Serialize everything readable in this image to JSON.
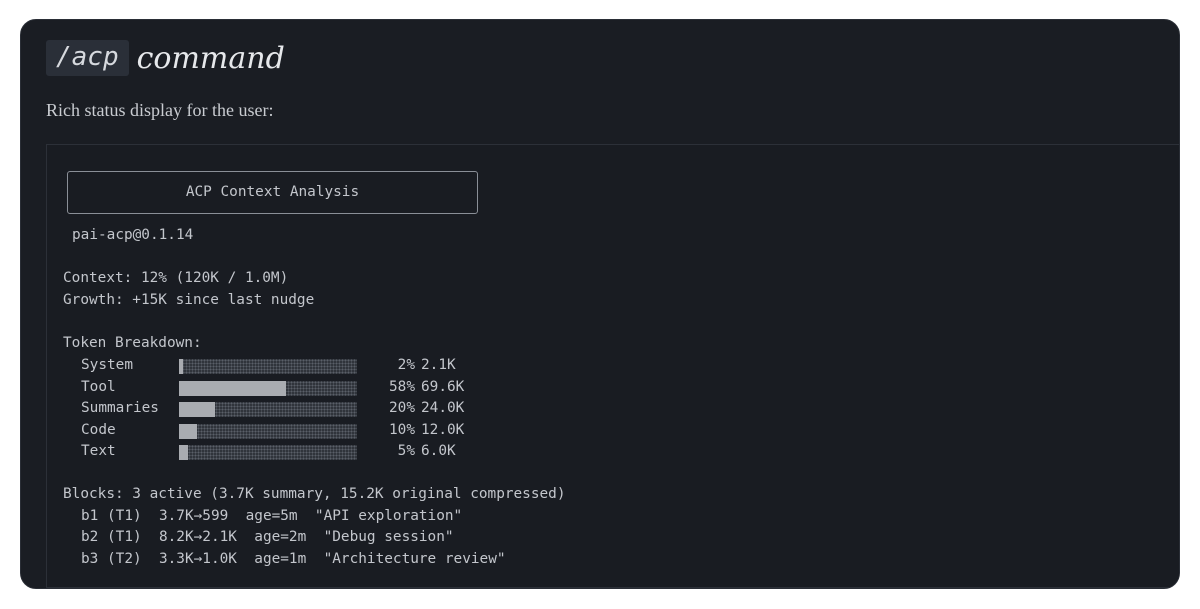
{
  "header": {
    "command": "/acp",
    "title_word": "command",
    "description": "Rich status display for the user:"
  },
  "terminal": {
    "box_title": "ACP Context Analysis",
    "version": "pai-acp@0.1.14",
    "context_line": "Context: 12% (120K / 1.0M)",
    "growth_line": "Growth: +15K since last nudge",
    "breakdown_heading": "Token Breakdown:",
    "breakdown": [
      {
        "name": "System",
        "fraction": 0.02,
        "pct": "2%",
        "tokens": "2.1K"
      },
      {
        "name": "Tool",
        "fraction": 0.6,
        "pct": "58%",
        "tokens": "69.6K"
      },
      {
        "name": "Summaries",
        "fraction": 0.2,
        "pct": "20%",
        "tokens": "24.0K"
      },
      {
        "name": "Code",
        "fraction": 0.1,
        "pct": "10%",
        "tokens": "12.0K"
      },
      {
        "name": "Text",
        "fraction": 0.05,
        "pct": "5%",
        "tokens": "6.0K"
      }
    ],
    "blocks_heading": "Blocks: 3 active (3.7K summary, 15.2K original compressed)",
    "blocks": [
      "b1 (T1)  3.7K→599  age=5m  \"API exploration\"",
      "b2 (T1)  8.2K→2.1K  age=2m  \"Debug session\"",
      "b3 (T2)  3.3K→1.0K  age=1m  \"Architecture review\""
    ]
  }
}
